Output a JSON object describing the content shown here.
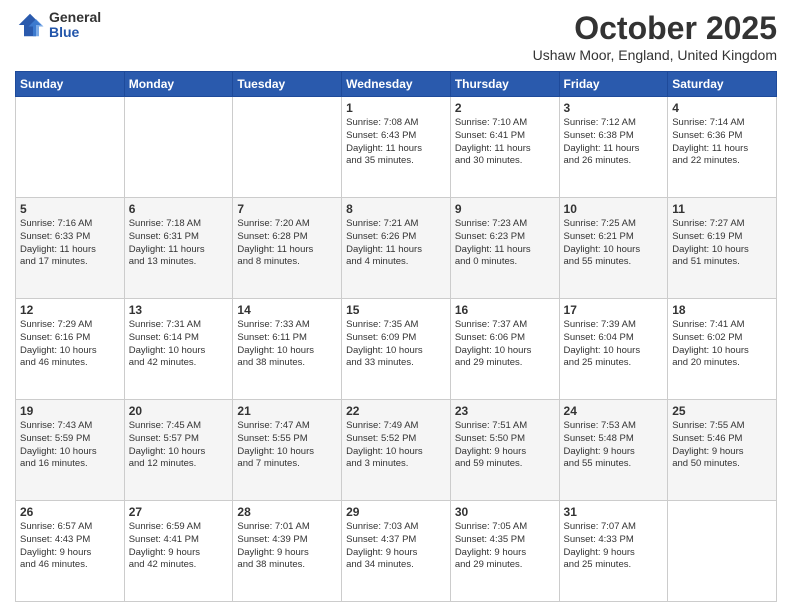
{
  "logo": {
    "general": "General",
    "blue": "Blue"
  },
  "title": "October 2025",
  "location": "Ushaw Moor, England, United Kingdom",
  "days": [
    "Sunday",
    "Monday",
    "Tuesday",
    "Wednesday",
    "Thursday",
    "Friday",
    "Saturday"
  ],
  "weeks": [
    [
      {
        "date": "",
        "info": ""
      },
      {
        "date": "",
        "info": ""
      },
      {
        "date": "",
        "info": ""
      },
      {
        "date": "1",
        "info": "Sunrise: 7:08 AM\nSunset: 6:43 PM\nDaylight: 11 hours\nand 35 minutes."
      },
      {
        "date": "2",
        "info": "Sunrise: 7:10 AM\nSunset: 6:41 PM\nDaylight: 11 hours\nand 30 minutes."
      },
      {
        "date": "3",
        "info": "Sunrise: 7:12 AM\nSunset: 6:38 PM\nDaylight: 11 hours\nand 26 minutes."
      },
      {
        "date": "4",
        "info": "Sunrise: 7:14 AM\nSunset: 6:36 PM\nDaylight: 11 hours\nand 22 minutes."
      }
    ],
    [
      {
        "date": "5",
        "info": "Sunrise: 7:16 AM\nSunset: 6:33 PM\nDaylight: 11 hours\nand 17 minutes."
      },
      {
        "date": "6",
        "info": "Sunrise: 7:18 AM\nSunset: 6:31 PM\nDaylight: 11 hours\nand 13 minutes."
      },
      {
        "date": "7",
        "info": "Sunrise: 7:20 AM\nSunset: 6:28 PM\nDaylight: 11 hours\nand 8 minutes."
      },
      {
        "date": "8",
        "info": "Sunrise: 7:21 AM\nSunset: 6:26 PM\nDaylight: 11 hours\nand 4 minutes."
      },
      {
        "date": "9",
        "info": "Sunrise: 7:23 AM\nSunset: 6:23 PM\nDaylight: 11 hours\nand 0 minutes."
      },
      {
        "date": "10",
        "info": "Sunrise: 7:25 AM\nSunset: 6:21 PM\nDaylight: 10 hours\nand 55 minutes."
      },
      {
        "date": "11",
        "info": "Sunrise: 7:27 AM\nSunset: 6:19 PM\nDaylight: 10 hours\nand 51 minutes."
      }
    ],
    [
      {
        "date": "12",
        "info": "Sunrise: 7:29 AM\nSunset: 6:16 PM\nDaylight: 10 hours\nand 46 minutes."
      },
      {
        "date": "13",
        "info": "Sunrise: 7:31 AM\nSunset: 6:14 PM\nDaylight: 10 hours\nand 42 minutes."
      },
      {
        "date": "14",
        "info": "Sunrise: 7:33 AM\nSunset: 6:11 PM\nDaylight: 10 hours\nand 38 minutes."
      },
      {
        "date": "15",
        "info": "Sunrise: 7:35 AM\nSunset: 6:09 PM\nDaylight: 10 hours\nand 33 minutes."
      },
      {
        "date": "16",
        "info": "Sunrise: 7:37 AM\nSunset: 6:06 PM\nDaylight: 10 hours\nand 29 minutes."
      },
      {
        "date": "17",
        "info": "Sunrise: 7:39 AM\nSunset: 6:04 PM\nDaylight: 10 hours\nand 25 minutes."
      },
      {
        "date": "18",
        "info": "Sunrise: 7:41 AM\nSunset: 6:02 PM\nDaylight: 10 hours\nand 20 minutes."
      }
    ],
    [
      {
        "date": "19",
        "info": "Sunrise: 7:43 AM\nSunset: 5:59 PM\nDaylight: 10 hours\nand 16 minutes."
      },
      {
        "date": "20",
        "info": "Sunrise: 7:45 AM\nSunset: 5:57 PM\nDaylight: 10 hours\nand 12 minutes."
      },
      {
        "date": "21",
        "info": "Sunrise: 7:47 AM\nSunset: 5:55 PM\nDaylight: 10 hours\nand 7 minutes."
      },
      {
        "date": "22",
        "info": "Sunrise: 7:49 AM\nSunset: 5:52 PM\nDaylight: 10 hours\nand 3 minutes."
      },
      {
        "date": "23",
        "info": "Sunrise: 7:51 AM\nSunset: 5:50 PM\nDaylight: 9 hours\nand 59 minutes."
      },
      {
        "date": "24",
        "info": "Sunrise: 7:53 AM\nSunset: 5:48 PM\nDaylight: 9 hours\nand 55 minutes."
      },
      {
        "date": "25",
        "info": "Sunrise: 7:55 AM\nSunset: 5:46 PM\nDaylight: 9 hours\nand 50 minutes."
      }
    ],
    [
      {
        "date": "26",
        "info": "Sunrise: 6:57 AM\nSunset: 4:43 PM\nDaylight: 9 hours\nand 46 minutes."
      },
      {
        "date": "27",
        "info": "Sunrise: 6:59 AM\nSunset: 4:41 PM\nDaylight: 9 hours\nand 42 minutes."
      },
      {
        "date": "28",
        "info": "Sunrise: 7:01 AM\nSunset: 4:39 PM\nDaylight: 9 hours\nand 38 minutes."
      },
      {
        "date": "29",
        "info": "Sunrise: 7:03 AM\nSunset: 4:37 PM\nDaylight: 9 hours\nand 34 minutes."
      },
      {
        "date": "30",
        "info": "Sunrise: 7:05 AM\nSunset: 4:35 PM\nDaylight: 9 hours\nand 29 minutes."
      },
      {
        "date": "31",
        "info": "Sunrise: 7:07 AM\nSunset: 4:33 PM\nDaylight: 9 hours\nand 25 minutes."
      },
      {
        "date": "",
        "info": ""
      }
    ]
  ]
}
